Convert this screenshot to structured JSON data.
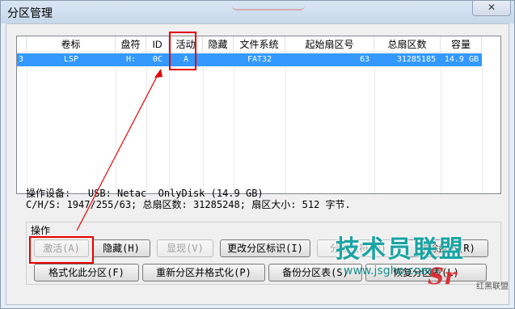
{
  "window": {
    "title": "分区管理",
    "close_label": "✕"
  },
  "columns": [
    "卷标",
    "盘符",
    "ID",
    "活动",
    "隐藏",
    "文件系统",
    "起始扇区号",
    "总扇区数",
    "容量"
  ],
  "rows": [
    {
      "index": "3",
      "label": "LSP",
      "drive": "H:",
      "id": "0C",
      "active": "A",
      "hidden": "",
      "fs": "FAT32",
      "start": "63",
      "total": "31285185",
      "capacity": "14.9 GB"
    }
  ],
  "device": {
    "line1": "操作设备:   USB: Netac  OnlyDisk (14.9 GB)",
    "line2": "C/H/S: 1947/255/63; 总扇区数: 31285248; 扇区大小: 512 字节."
  },
  "ops": {
    "label": "操作",
    "buttons_row1": [
      {
        "label": "激活(A)",
        "disabled": true
      },
      {
        "label": "隐藏(H)",
        "disabled": false
      },
      {
        "label": "显现(V)",
        "disabled": true
      },
      {
        "label": "更改分区标识(I)",
        "disabled": false
      },
      {
        "label": "分配盘符(D)",
        "disabled": true
      },
      {
        "label": "删除盘符(R)",
        "disabled": false
      }
    ],
    "buttons_row2": [
      {
        "label": "格式化此分区(F)",
        "disabled": false
      },
      {
        "label": "重新分区并格式化(P)",
        "disabled": false
      },
      {
        "label": "备份分区表(S)",
        "disabled": false
      },
      {
        "label": "恢复分区表(L)",
        "disabled": false
      }
    ]
  },
  "watermark": {
    "main": "技术员联盟",
    "url": "www.jsgho.com",
    "small": "红黑联盟",
    "logo": "Sr"
  },
  "colors": {
    "selection": "#3399ff",
    "highlight_box": "#e60000",
    "watermark": "#1aa3a3"
  }
}
